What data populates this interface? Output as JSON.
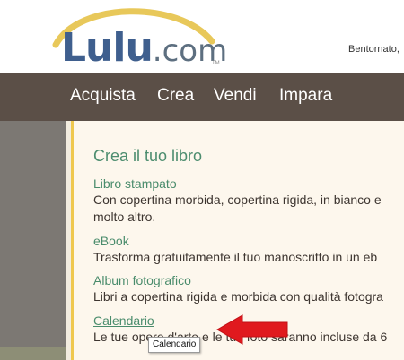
{
  "header": {
    "logo": {
      "name": "Lulu",
      "suffix": ".com",
      "tm": "TM"
    },
    "welcome": "Bentornato,"
  },
  "nav": {
    "items": [
      {
        "label": "Acquista"
      },
      {
        "label": "Crea"
      },
      {
        "label": "Vendi"
      },
      {
        "label": "Impara"
      }
    ]
  },
  "dropdown": {
    "title": "Crea il tuo libro",
    "items": [
      {
        "label": "Libro stampato",
        "desc": [
          "Con copertina morbida, copertina rigida, in bianco e",
          "molto altro."
        ]
      },
      {
        "label": "eBook",
        "desc": [
          "Trasforma gratuitamente il tuo manoscritto in un eb"
        ]
      },
      {
        "label": "Album fotografico",
        "desc": [
          "Libri a copertina rigida e morbida con qualità fotogra"
        ]
      },
      {
        "label": "Calendario",
        "desc": [
          "Le tue opere d'arte e le tue foto saranno incluse da 6"
        ]
      }
    ]
  },
  "tooltip": {
    "text": "Calendario"
  },
  "colors": {
    "nav_bg": "#5b4f47",
    "link_green": "#4a8c6c",
    "accent_yellow": "#efc84f",
    "arrow_red": "#e0191e",
    "logo_blue": "#3f5f8e"
  }
}
